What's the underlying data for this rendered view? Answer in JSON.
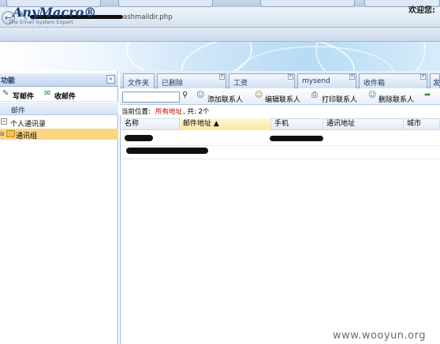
{
  "browser": {
    "url_visible": "ashmaildir.php"
  },
  "app": {
    "logo": "AnyMacro®",
    "tagline": "The Email System Expert",
    "welcome": "欢迎您:"
  },
  "sidebar": {
    "title": "功能",
    "compose": "写邮件",
    "receive": "收邮件",
    "mail": "邮件",
    "personal_contacts": "个人通讯录",
    "contact_group": "通讯组"
  },
  "tabs": [
    {
      "label": "文件夹"
    },
    {
      "label": "已删除"
    },
    {
      "label": "工资"
    },
    {
      "label": "mysend"
    },
    {
      "label": "收件箱"
    },
    {
      "label": "发"
    }
  ],
  "toolbar": {
    "add_contact": "添加联系人",
    "edit_contact": "编辑联系人",
    "print_contact": "打印联系人",
    "delete_contact": "删除联系人"
  },
  "breadcrumb": {
    "prefix": "当前位置:",
    "location": "所有地址",
    "count": ", 共: 2个"
  },
  "table": {
    "columns": [
      "名称",
      "邮件地址 ▲",
      "手机",
      "通讯地址",
      "城市"
    ]
  },
  "watermark": "www.wooyun.org"
}
